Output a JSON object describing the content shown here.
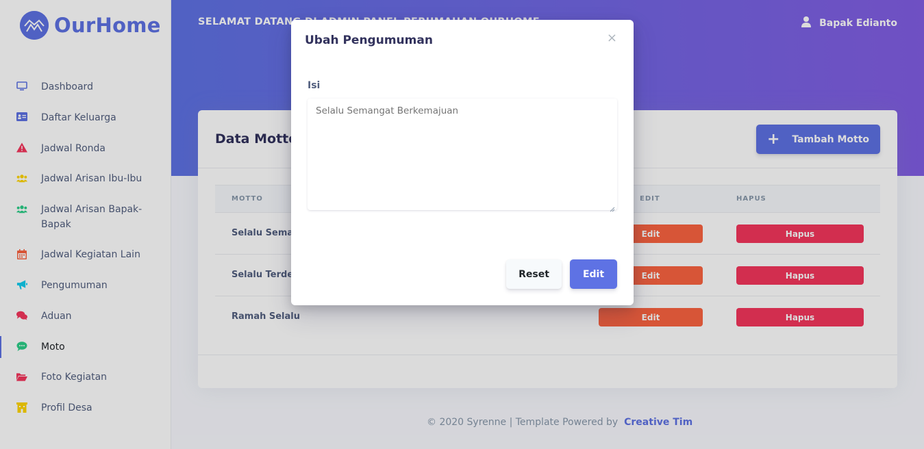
{
  "brand": {
    "name": "OurHome",
    "color": "#5e72e4"
  },
  "header": {
    "welcome": "SELAMAT DATANG DI ADMIN PANEL PERUMAHAN OURHOME",
    "user_name": "Bapak Edianto"
  },
  "sidebar": {
    "items": [
      {
        "label": "Dashboard",
        "icon": "tv-icon",
        "color": "#5e72e4"
      },
      {
        "label": "Daftar Keluarga",
        "icon": "id-card-icon",
        "color": "#5e72e4"
      },
      {
        "label": "Jadwal Ronda",
        "icon": "warning-icon",
        "color": "#f5365c"
      },
      {
        "label": "Jadwal Arisan Ibu-Ibu",
        "icon": "users-icon",
        "color": "#ffd600"
      },
      {
        "label": "Jadwal Arisan Bapak-Bapak",
        "icon": "users-icon",
        "color": "#2dce89"
      },
      {
        "label": "Jadwal Kegiatan Lain",
        "icon": "calendar-icon",
        "color": "#fb6340"
      },
      {
        "label": "Pengumuman",
        "icon": "megaphone-icon",
        "color": "#11cdef"
      },
      {
        "label": "Aduan",
        "icon": "chat-bubbles-icon",
        "color": "#f5365c"
      },
      {
        "label": "Moto",
        "icon": "chat-bubble-icon",
        "color": "#2dce89",
        "active": true
      },
      {
        "label": "Foto Kegiatan",
        "icon": "folder-open-icon",
        "color": "#f5365c"
      },
      {
        "label": "Profil Desa",
        "icon": "building-icon",
        "color": "#ffd600"
      }
    ]
  },
  "card": {
    "title": "Data Motto",
    "add_button": "Tambah Motto",
    "columns": {
      "motto": "MOTTO",
      "edit": "EDIT",
      "hapus": "HAPUS"
    },
    "rows": [
      {
        "motto": "Selalu Semangat Berkemajuan",
        "edit": "Edit",
        "hapus": "Hapus"
      },
      {
        "motto": "Selalu Terdepan",
        "edit": "Edit",
        "hapus": "Hapus"
      },
      {
        "motto": "Ramah Selalu",
        "edit": "Edit",
        "hapus": "Hapus"
      }
    ]
  },
  "footer": {
    "text": "© 2020 Syrenne | Template Powered by",
    "link": "Creative Tim"
  },
  "modal": {
    "title": "Ubah Pengumuman",
    "close": "×",
    "field_label": "Isi",
    "textarea_placeholder": "Selalu Semangat Berkemajuan",
    "reset_button": "Reset",
    "submit_button": "Edit"
  }
}
